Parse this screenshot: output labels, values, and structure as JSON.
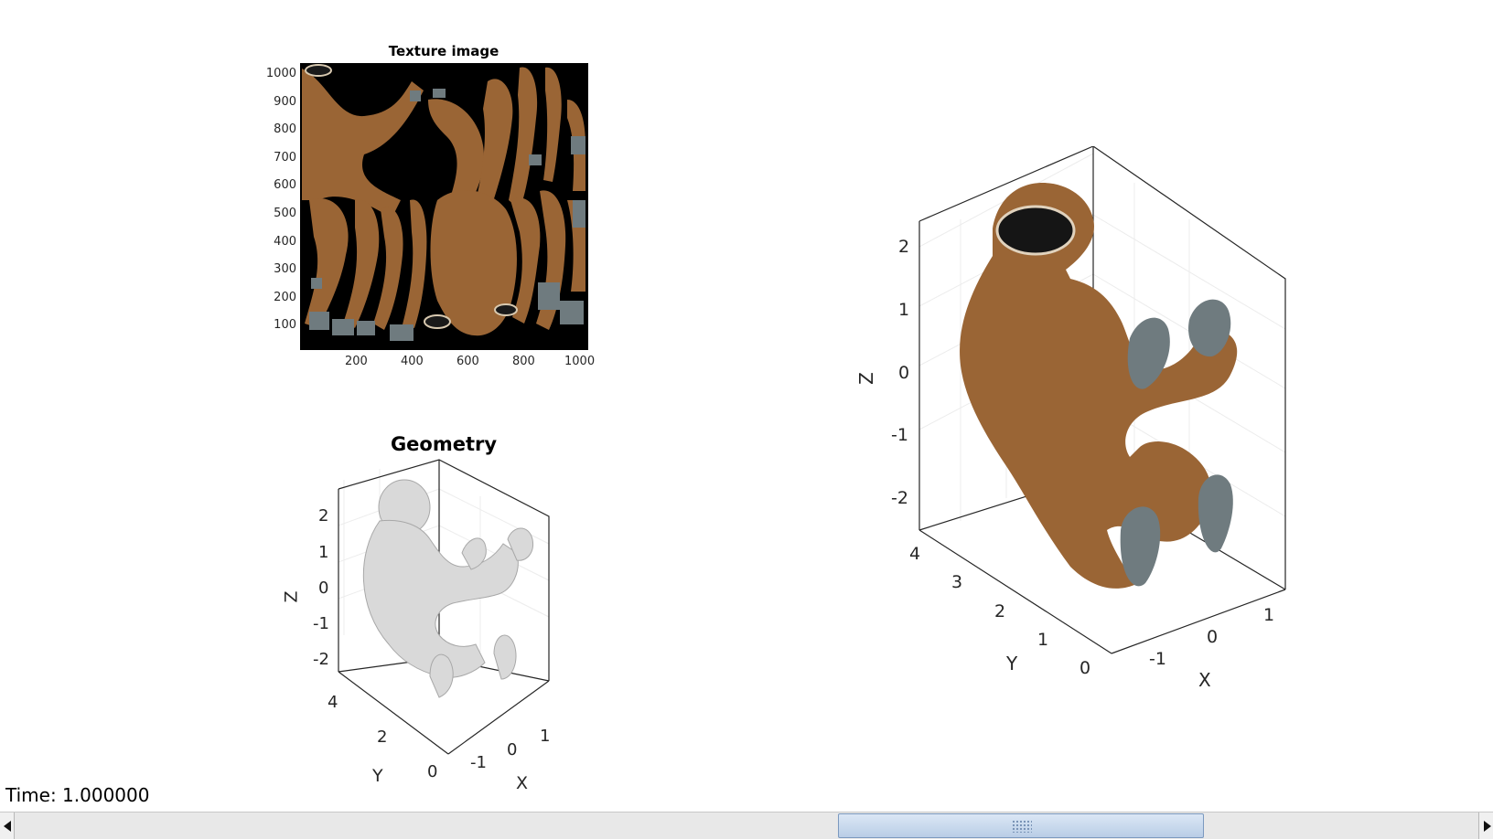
{
  "texture_panel": {
    "title": "Texture image",
    "yticks": [
      "1000",
      "900",
      "800",
      "700",
      "600",
      "500",
      "400",
      "300",
      "200",
      "100"
    ],
    "xticks": [
      "200",
      "400",
      "600",
      "800",
      "1000"
    ],
    "xlim": [
      0,
      1000
    ],
    "ylim": [
      0,
      1000
    ]
  },
  "geometry_panel": {
    "title": "Geometry",
    "zticks": [
      "2",
      "1",
      "0",
      "-1",
      "-2"
    ],
    "yticks": [
      "4",
      "2",
      "0"
    ],
    "xticks": [
      "-1",
      "0",
      "1"
    ],
    "zlabel": "Z",
    "ylabel": "Y",
    "xlabel": "X",
    "surface_color": "#d9d9d9"
  },
  "textured_panel": {
    "zticks": [
      "2",
      "1",
      "0",
      "-1",
      "-2"
    ],
    "yticks": [
      "4",
      "3",
      "2",
      "1",
      "0"
    ],
    "xticks": [
      "-1",
      "0",
      "1"
    ],
    "zlabel": "Z",
    "ylabel": "Y",
    "xlabel": "X",
    "fur_color": "#9a6535",
    "hand_color": "#6f7b7f"
  },
  "status": {
    "time_label": "Time: 1.000000"
  },
  "scrollbar": {
    "position": 0.75
  }
}
